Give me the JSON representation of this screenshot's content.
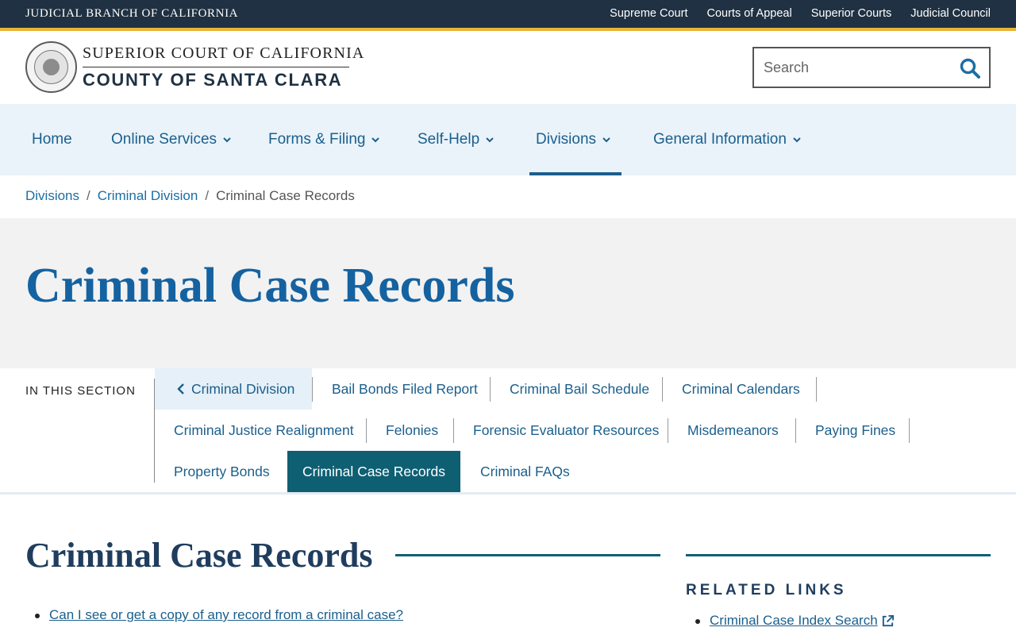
{
  "topbar": {
    "branch_title": "JUDICIAL BRANCH OF CALIFORNIA",
    "links": [
      "Supreme Court",
      "Courts of Appeal",
      "Superior Courts",
      "Judicial Council"
    ]
  },
  "header": {
    "court_line1": "SUPERIOR COURT OF CALIFORNIA",
    "court_line2": "COUNTY OF SANTA CLARA",
    "search_placeholder": "Search"
  },
  "nav": {
    "items": [
      {
        "label": "Home"
      },
      {
        "label": "Online Services"
      },
      {
        "label": "Forms & Filing"
      },
      {
        "label": "Self-Help"
      },
      {
        "label": "Divisions"
      },
      {
        "label": "General Information"
      }
    ],
    "active": "Divisions"
  },
  "breadcrumb": {
    "items": [
      "Divisions",
      "Criminal Division"
    ],
    "current": "Criminal Case Records"
  },
  "hero": {
    "title": "Criminal Case Records"
  },
  "in_section": {
    "label": "IN THIS SECTION",
    "back": "Criminal Division",
    "items": [
      "Bail Bonds Filed Report",
      "Criminal Bail Schedule",
      "Criminal Calendars",
      "Criminal Justice Realignment",
      "Felonies",
      "Forensic Evaluator Resources",
      "Misdemeanors",
      "Paying Fines",
      "Property Bonds",
      "Criminal Case Records",
      "Criminal FAQs"
    ],
    "active": "Criminal Case Records"
  },
  "content": {
    "title": "Criminal Case Records",
    "links": [
      "Can I see or get a copy of any record from a criminal case?"
    ]
  },
  "sidebar": {
    "title": "RELATED LINKS",
    "links": [
      "Criminal Case Index Search"
    ]
  },
  "colors": {
    "topbar": "#1f3142",
    "gold": "#e8b436",
    "link_blue": "#1b5f8c",
    "active_teal": "#0f5f73",
    "nav_bg": "#eaf3fa",
    "hero_bg": "#f2f2f2"
  },
  "icons": {
    "search": "search-icon",
    "nav_chevron": "chevron-down-icon",
    "back": "chevron-left-icon",
    "external": "external-link-icon",
    "seal": "court-seal-logo"
  }
}
